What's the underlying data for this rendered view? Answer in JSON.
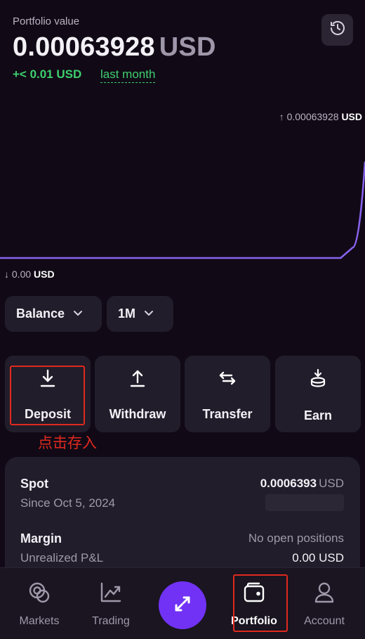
{
  "portfolio": {
    "label": "Portfolio value",
    "value": "0.00063928",
    "currency": "USD",
    "change": "+< 0.01 USD",
    "period": "last month"
  },
  "chart": {
    "high_value": "↑ 0.00063928",
    "high_unit": "USD",
    "low_value": "↓ 0.00",
    "low_unit": "USD",
    "line_color": "#8a63f0"
  },
  "chart_data": {
    "type": "line",
    "x": [
      0,
      1,
      2,
      3,
      4,
      5,
      6,
      7,
      8,
      9,
      10,
      11,
      12,
      13,
      14,
      15,
      16,
      17,
      18,
      19,
      20,
      21,
      22,
      23,
      24,
      25,
      26,
      27,
      28,
      29,
      30
    ],
    "values": [
      0,
      0,
      0,
      0,
      0,
      0,
      0,
      0,
      0,
      0,
      0,
      0,
      0,
      0,
      0,
      0,
      0,
      0,
      0,
      0,
      0,
      0,
      0,
      0,
      0,
      0,
      0,
      0,
      0,
      7e-05,
      0.00063928
    ],
    "ylim": [
      0,
      0.00063928
    ]
  },
  "filters": {
    "balance_label": "Balance",
    "period_label": "1M"
  },
  "actions": {
    "deposit": "Deposit",
    "withdraw": "Withdraw",
    "transfer": "Transfer",
    "earn": "Earn"
  },
  "annotation": "点击存入",
  "holdings": {
    "spot": {
      "title": "Spot",
      "sub": "Since Oct 5, 2024",
      "value": "0.0006393",
      "currency": "USD"
    },
    "margin": {
      "title": "Margin",
      "sub": "Unrealized P&L",
      "status": "No open positions",
      "value": "0.00 USD"
    }
  },
  "nav": {
    "markets": "Markets",
    "trading": "Trading",
    "portfolio": "Portfolio",
    "account": "Account"
  },
  "colors": {
    "accent": "#7132f5",
    "positive": "#3ecf6e",
    "annotation": "#e0291e"
  }
}
